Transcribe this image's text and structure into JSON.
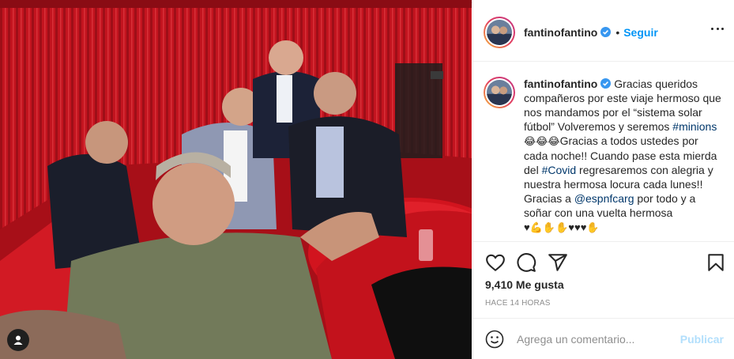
{
  "post": {
    "username": "fantinofantino",
    "follow_label": "Seguir",
    "dot": "•",
    "caption": {
      "username": "fantinofantino",
      "part1": " Gracias queridos compañeros por este viaje hermoso que nos mandamos por el “sistema solar fútbol” Volveremos y seremos ",
      "hashtag_minions": "#minions",
      "emojis1": " 😂😂😂 ",
      "part2": "Gracias a todos ustedes por cada noche!! Cuando pase esta mierda del ",
      "hashtag_covid": "#Covid",
      "part3": " regresaremos con alegria y nuestra hermosa locura cada lunes!! Gracias a ",
      "mention": "@espnfcarg",
      "part4": " por todo y a soñar con una vuelta hermosa ",
      "emojis2": "♥💪✋✋♥♥♥✋"
    },
    "likes": "9,410 Me gusta",
    "time": "HACE 14 HORAS",
    "comment_placeholder": "Agrega un comentario...",
    "publish_label": "Publicar"
  },
  "icons": {
    "verified": "verified-badge-icon",
    "more": "more-options-icon",
    "like": "heart-icon",
    "comment": "comment-icon",
    "share": "share-icon",
    "save": "bookmark-icon",
    "emoji": "emoji-icon",
    "user_tag": "user-tag-icon"
  },
  "colors": {
    "accent": "#0095f6",
    "link": "#00376b",
    "muted": "#8e8e8e",
    "publish_disabled": "#b2dffc",
    "studio_red": "#b3121b"
  }
}
